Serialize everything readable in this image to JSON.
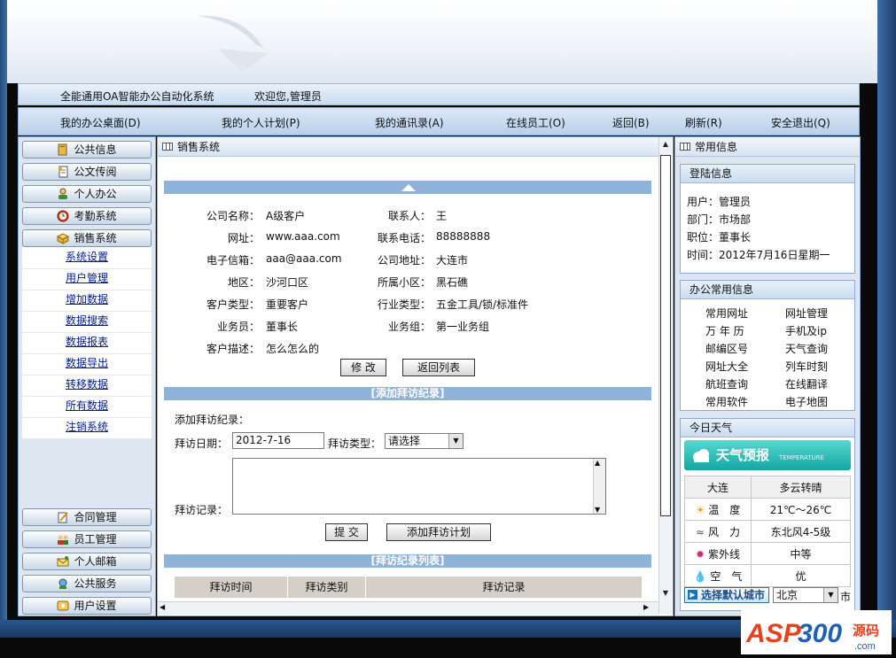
{
  "topbar": {
    "system_name": "全能通用OA智能办公自动化系统",
    "welcome": "欢迎您,管理员"
  },
  "nav": [
    {
      "label": "我的办公桌面(D)"
    },
    {
      "label": "我的个人计划(P)"
    },
    {
      "label": "我的通讯录(A)"
    },
    {
      "label": "在线员工(O)"
    },
    {
      "label": "返回(B)"
    },
    {
      "label": "刷新(R)"
    },
    {
      "label": "安全退出(Q)"
    }
  ],
  "left_menu": {
    "top_groups": [
      {
        "label": "公共信息",
        "icon": "book-icon"
      },
      {
        "label": "公文传阅",
        "icon": "document-icon"
      },
      {
        "label": "个人办公",
        "icon": "person-icon"
      },
      {
        "label": "考勤系统",
        "icon": "clock-icon"
      },
      {
        "label": "销售系统",
        "icon": "box-icon"
      }
    ],
    "sub_items": [
      "系统设置",
      "用户管理",
      "增加数据",
      "数据搜索",
      "数据报表",
      "数据导出",
      "转移数据",
      "所有数据",
      "注销系统"
    ],
    "bottom_groups": [
      {
        "label": "合同管理",
        "icon": "contract-icon"
      },
      {
        "label": "员工管理",
        "icon": "people-icon"
      },
      {
        "label": "个人邮箱",
        "icon": "mail-icon"
      },
      {
        "label": "公共服务",
        "icon": "service-icon"
      },
      {
        "label": "用户设置",
        "icon": "user-settings-icon"
      }
    ]
  },
  "main": {
    "title": "销售系统",
    "fields": {
      "company_label": "公司名称：",
      "company": "A级客户",
      "contact_label": "联系人：",
      "contact": "王",
      "website_label": "网址：",
      "website": "www.aaa.com",
      "phone_label": "联系电话：",
      "phone": "88888888",
      "email_label": "电子信箱：",
      "email": "aaa@aaa.com",
      "address_label": "公司地址：",
      "address": "大连市",
      "area_label": "地区：",
      "area": "沙河口区",
      "district_label": "所属小区：",
      "district": "黑石礁",
      "ctype_label": "客户类型：",
      "ctype": "重要客户",
      "industry_label": "行业类型：",
      "industry": "五金工具/锁/标准件",
      "salesman_label": "业务员：",
      "salesman": "董事长",
      "group_label": "业务组：",
      "group": "第一业务组",
      "desc_label": "客户描述：",
      "desc": "怎么怎么的"
    },
    "edit_button": "修 改",
    "back_button": "返回列表",
    "add_visit_header": "[添加拜访纪录]",
    "add_visit_label": "添加拜访纪录：",
    "visit_date_label": "拜访日期：",
    "visit_date_value": "2012-7-16",
    "visit_type_label": "拜访类型：",
    "visit_type_value": "请选择",
    "visit_record_label": "拜访记录：",
    "submit_button": "提 交",
    "add_plan_button": "添加拜访计划",
    "visit_list_header": "[拜访纪录列表]",
    "table_headers": [
      "拜访时间",
      "拜访类别",
      "拜访记录"
    ]
  },
  "right": {
    "title": "常用信息",
    "login": {
      "header": "登陆信息",
      "user": "用户：管理员",
      "dept": "部门：市场部",
      "position": "职位：董事长",
      "time": "时间：2012年7月16日星期一"
    },
    "office": {
      "header": "办公常用信息",
      "links": [
        "常用网址",
        "网址管理",
        "万 年 历",
        "手机及ip",
        "邮编区号",
        "天气查询",
        "网址大全",
        "列车时刻",
        "航班查询",
        "在线翻译",
        "常用软件",
        "电子地图"
      ]
    },
    "weather": {
      "header": "今日天气",
      "banner": "天气预报",
      "banner_sub": "TEMPERATURE",
      "city": "大连",
      "condition": "多云转晴",
      "rows": [
        {
          "icon": "sun-icon",
          "label": "温　度",
          "value": "21℃～26℃"
        },
        {
          "icon": "wind-icon",
          "label": "风　力",
          "value": "东北风4-5级"
        },
        {
          "icon": "uv-icon",
          "label": "紫外线",
          "value": "中等"
        },
        {
          "icon": "air-icon",
          "label": "空　气",
          "value": "优"
        }
      ],
      "city_button": "选择默认城市",
      "city_select": "北京",
      "city_suffix": "市"
    }
  },
  "logo": {
    "text": "ASP300",
    "sub": "源码",
    "domain": ".com"
  }
}
